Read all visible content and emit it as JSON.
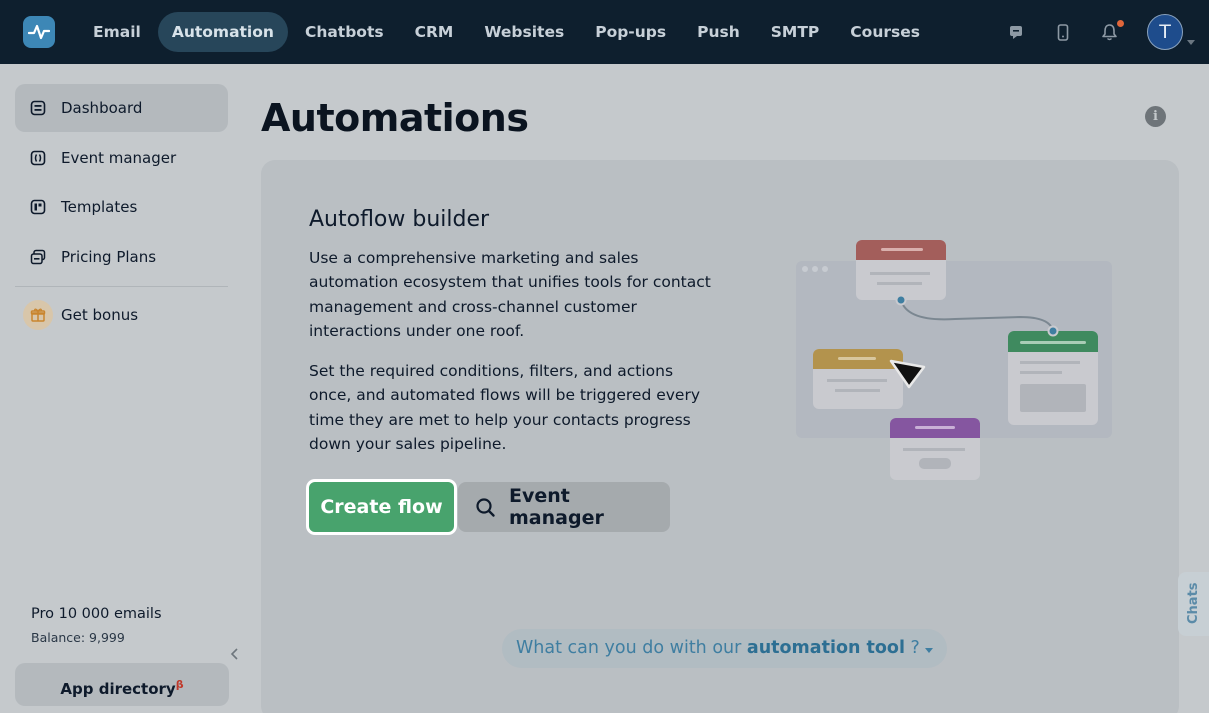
{
  "topnav": {
    "items": [
      "Email",
      "Automation",
      "Chatbots",
      "CRM",
      "Websites",
      "Pop-ups",
      "Push",
      "SMTP",
      "Courses"
    ],
    "active": "Automation",
    "avatar_letter": "T",
    "icons": [
      "chat-icon",
      "mobile-icon",
      "bell-icon"
    ]
  },
  "sidebar": {
    "items": [
      {
        "label": "Dashboard",
        "icon": "dashboard-icon"
      },
      {
        "label": "Event manager",
        "icon": "event-manager-icon"
      },
      {
        "label": "Templates",
        "icon": "templates-icon"
      },
      {
        "label": "Pricing Plans",
        "icon": "pricing-plans-icon"
      },
      {
        "label": "Get bonus",
        "icon": "gift-icon"
      }
    ],
    "plan_name": "Pro 10 000 emails",
    "balance": "Balance: 9,999",
    "app_directory": "App directory",
    "app_directory_badge": "β"
  },
  "main": {
    "title": "Automations",
    "card": {
      "title": "Autoflow builder",
      "paragraph1": "Use a comprehensive marketing and sales automation ecosystem that unifies tools for contact management and cross-channel customer interactions under one roof.",
      "paragraph2": "Set the required conditions, filters, and actions once, and automated flows will be triggered every time they are met to help your contacts progress down your sales pipeline.",
      "primary_button": "Create flow",
      "secondary_button": "Event manager"
    },
    "question": {
      "prefix": "What can you do with our",
      "highlight": "automation tool",
      "suffix": "?"
    }
  },
  "chats_tab": "Chats",
  "colors": {
    "topbar": "#0e1f2e",
    "primary_green": "#48a36d",
    "accent_blue": "#3d87b6"
  }
}
